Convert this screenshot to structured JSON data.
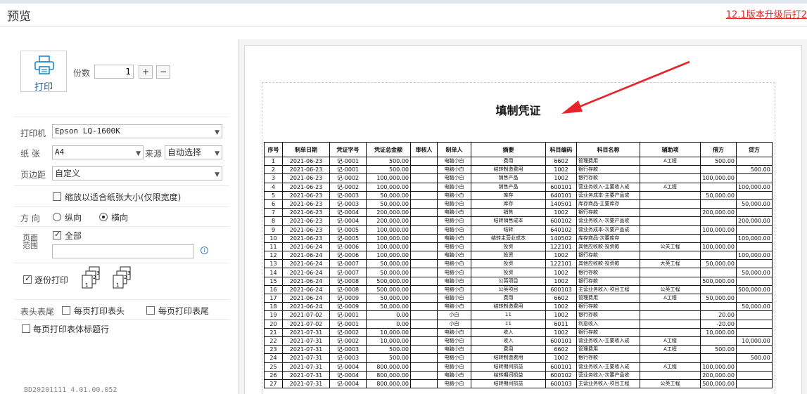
{
  "window": {
    "title": "预览",
    "upgrade_link": "12.1版本升级后打2"
  },
  "print_panel": {
    "print_button_label": "打印",
    "copies_label": "份数",
    "copies_value": "1",
    "plus_label": "+",
    "minus_label": "−",
    "printer_label": "打印机",
    "printer_value": "Epson LQ-1600K",
    "paper_label": "纸  张",
    "paper_value": "A4",
    "source_label": "来源",
    "source_value": "自动选择",
    "margin_label": "页边距",
    "margin_value": "自定义",
    "fit_label": "缩放以适合纸张大小(仅限宽度)",
    "direction_label": "方  向",
    "portrait_label": "纵向",
    "landscape_label": "横向",
    "range_label_1": "页面",
    "range_label_2": "范围",
    "all_label": "全部",
    "collate_label": "逐份打印",
    "header_footer_label": "表头表尾",
    "each_page_header": "每页打印表头",
    "each_page_footer": "每页打印表尾",
    "each_page_title_row": "每页打印表体标题行",
    "version": "BD20201111 4.01.00.052"
  },
  "voucher": {
    "title": "填制凭证",
    "columns": [
      "序号",
      "制单日期",
      "凭证字号",
      "凭证总金额",
      "审核人",
      "制单人",
      "摘要",
      "科目编码",
      "科目名称",
      "辅助项",
      "借方",
      "贷方"
    ],
    "rows": [
      [
        "1",
        "2021-06-23",
        "记-0001",
        "500.00",
        "",
        "电脑小白",
        "费用",
        "6602",
        "管理费用",
        "A工程",
        "500.00",
        ""
      ],
      [
        "2",
        "2021-06-23",
        "记-0001",
        "500.00",
        "",
        "电脑小白",
        "结转制造费用",
        "1002",
        "银行存款",
        "",
        "",
        "500.00"
      ],
      [
        "3",
        "2021-06-23",
        "记-0002",
        "100,000.00",
        "",
        "电脑小白",
        "销售产品",
        "1002",
        "银行存款",
        "",
        "100,000.00",
        ""
      ],
      [
        "4",
        "2021-06-23",
        "记-0002",
        "100,000.00",
        "",
        "电脑小白",
        "销售产品",
        "600101",
        "营业务收入-主要收入成",
        "A工程",
        "",
        "100,000.00"
      ],
      [
        "5",
        "2021-06-23",
        "记-0003",
        "50,000.00",
        "",
        "电脑小白",
        "库存",
        "640101",
        "营业务成本-主要产品成",
        "",
        "50,000.00",
        ""
      ],
      [
        "6",
        "2021-06-23",
        "记-0003",
        "50,000.00",
        "",
        "电脑小白",
        "库存",
        "140501",
        "库存商品-主要库存",
        "",
        "",
        "50,000.00"
      ],
      [
        "7",
        "2021-06-23",
        "记-0004",
        "200,000.00",
        "",
        "电脑小白",
        "销售",
        "1002",
        "银行存款",
        "",
        "200,000.00",
        ""
      ],
      [
        "8",
        "2021-06-23",
        "记-0004",
        "200,000.00",
        "",
        "电脑小白",
        "结转销售成本",
        "600102",
        "营业务收入-次要产品收",
        "",
        "",
        "200,000.00"
      ],
      [
        "9",
        "2021-06-23",
        "记-0005",
        "100,000.00",
        "",
        "电脑小白",
        "结转",
        "640102",
        "营业务成本-次要产品成",
        "",
        "100,000.00",
        ""
      ],
      [
        "10",
        "2021-06-23",
        "记-0005",
        "100,000.00",
        "",
        "电脑小白",
        "结转主营业成本",
        "140502",
        "库存商品-次要库存",
        "",
        "",
        "100,000.00"
      ],
      [
        "11",
        "2021-06-24",
        "记-0006",
        "100,000.00",
        "",
        "电脑小白",
        "投资",
        "122101",
        "其他应收款-投资款",
        "公关工程",
        "100,000.00",
        ""
      ],
      [
        "12",
        "2021-06-24",
        "记-0006",
        "100,000.00",
        "",
        "电脑小白",
        "投资",
        "1002",
        "银行存款",
        "",
        "",
        "100,000.00"
      ],
      [
        "13",
        "2021-06-24",
        "记-0007",
        "50,000.00",
        "",
        "电脑小白",
        "投资",
        "122101",
        "其他应收款-投资款",
        "大英工程",
        "50,000.00",
        ""
      ],
      [
        "14",
        "2021-06-24",
        "记-0007",
        "50,000.00",
        "",
        "电脑小白",
        "投资",
        "1002",
        "银行存款",
        "",
        "",
        "50,000.00"
      ],
      [
        "15",
        "2021-06-24",
        "记-0008",
        "500,000.00",
        "",
        "电脑小白",
        "公英项目",
        "1002",
        "银行存款",
        "",
        "500,000.00",
        ""
      ],
      [
        "16",
        "2021-06-24",
        "记-0008",
        "500,000.00",
        "",
        "电脑小白",
        "公英项目",
        "600103",
        "主营业务收入-项目工程",
        "公英工程",
        "",
        "500,000.00"
      ],
      [
        "17",
        "2021-06-24",
        "记-0009",
        "50,000.00",
        "",
        "电脑小白",
        "费用",
        "6602",
        "管理费用",
        "A工程",
        "50,000.00",
        ""
      ],
      [
        "18",
        "2021-06-24",
        "记-0009",
        "50,000.00",
        "",
        "电脑小白",
        "结转制造费用",
        "1002",
        "银行存款",
        "",
        "",
        "50,000.00"
      ],
      [
        "19",
        "2021-07-02",
        "记-0001",
        "0.00",
        "",
        "小白",
        "11",
        "1002",
        "银行存款",
        "",
        "20.00",
        ""
      ],
      [
        "20",
        "2021-07-02",
        "记-0001",
        "0.00",
        "",
        "小白",
        "11",
        "6011",
        "利息收入",
        "",
        "-20.00",
        ""
      ],
      [
        "21",
        "2021-07-31",
        "记-0002",
        "10,000.00",
        "",
        "电脑小白",
        "收入",
        "1002",
        "银行存款",
        "",
        "10,000.00",
        ""
      ],
      [
        "22",
        "2021-07-31",
        "记-0002",
        "10,000.00",
        "",
        "电脑小白",
        "收入",
        "600101",
        "营业务收入-主要收入成",
        "A工程",
        "",
        "10,000.00"
      ],
      [
        "23",
        "2021-07-31",
        "记-0003",
        "500.00",
        "",
        "电脑小白",
        "费用",
        "6602",
        "管理费用",
        "A工程",
        "500.00",
        ""
      ],
      [
        "24",
        "2021-07-31",
        "记-0003",
        "500.00",
        "",
        "电脑小白",
        "结转制造费用",
        "1002",
        "银行存款",
        "",
        "",
        "500.00"
      ],
      [
        "25",
        "2021-07-31",
        "记-0004",
        "800,000.00",
        "",
        "电脑小白",
        "结转期间损益",
        "600101",
        "营业务收入-主要收入成",
        "A工程",
        "100,000.00",
        ""
      ],
      [
        "26",
        "2021-07-31",
        "记-0004",
        "800,000.00",
        "",
        "电脑小白",
        "结转期间损益",
        "600102",
        "营业务收入-次要产品收",
        "",
        "200,000.00",
        ""
      ],
      [
        "27",
        "2021-07-31",
        "记-0004",
        "800,000.00",
        "",
        "电脑小白",
        "结转期间损益",
        "600103",
        "主营业务收入-项目工程",
        "公英工程",
        "500,000.00",
        ""
      ]
    ]
  }
}
